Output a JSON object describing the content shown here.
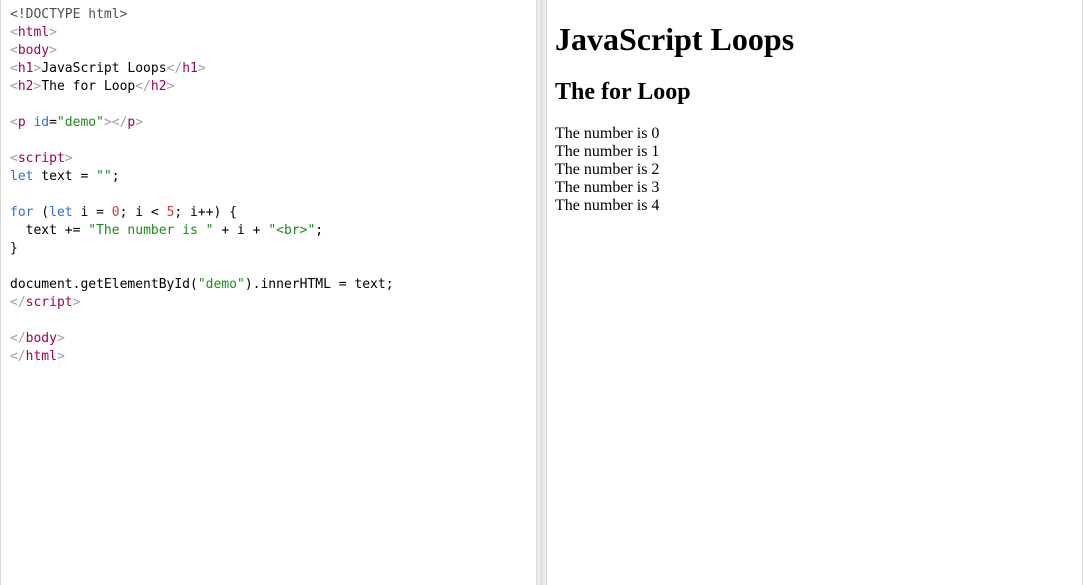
{
  "editor": {
    "lines": [
      [
        {
          "t": "doctype",
          "v": "<!DOCTYPE html>"
        }
      ],
      [
        {
          "t": "bracket",
          "v": "<"
        },
        {
          "t": "tag",
          "v": "html"
        },
        {
          "t": "bracket",
          "v": ">"
        }
      ],
      [
        {
          "t": "bracket",
          "v": "<"
        },
        {
          "t": "tag",
          "v": "body"
        },
        {
          "t": "bracket",
          "v": ">"
        }
      ],
      [
        {
          "t": "bracket",
          "v": "<"
        },
        {
          "t": "tag",
          "v": "h1"
        },
        {
          "t": "bracket",
          "v": ">"
        },
        {
          "t": "text",
          "v": "JavaScript Loops"
        },
        {
          "t": "bracket",
          "v": "</"
        },
        {
          "t": "tag",
          "v": "h1"
        },
        {
          "t": "bracket",
          "v": ">"
        }
      ],
      [
        {
          "t": "bracket",
          "v": "<"
        },
        {
          "t": "tag",
          "v": "h2"
        },
        {
          "t": "bracket",
          "v": ">"
        },
        {
          "t": "text",
          "v": "The for Loop"
        },
        {
          "t": "bracket",
          "v": "</"
        },
        {
          "t": "tag",
          "v": "h2"
        },
        {
          "t": "bracket",
          "v": ">"
        }
      ],
      [],
      [
        {
          "t": "bracket",
          "v": "<"
        },
        {
          "t": "tag",
          "v": "p"
        },
        {
          "t": "text",
          "v": " "
        },
        {
          "t": "attr",
          "v": "id"
        },
        {
          "t": "text",
          "v": "="
        },
        {
          "t": "str",
          "v": "\"demo\""
        },
        {
          "t": "bracket",
          "v": "></"
        },
        {
          "t": "tag",
          "v": "p"
        },
        {
          "t": "bracket",
          "v": ">"
        }
      ],
      [],
      [
        {
          "t": "bracket",
          "v": "<"
        },
        {
          "t": "tag",
          "v": "script"
        },
        {
          "t": "bracket",
          "v": ">"
        }
      ],
      [
        {
          "t": "kw",
          "v": "let"
        },
        {
          "t": "text",
          "v": " text = "
        },
        {
          "t": "str",
          "v": "\"\""
        },
        {
          "t": "text",
          "v": ";"
        }
      ],
      [],
      [
        {
          "t": "kw",
          "v": "for"
        },
        {
          "t": "text",
          "v": " ("
        },
        {
          "t": "kw",
          "v": "let"
        },
        {
          "t": "text",
          "v": " i = "
        },
        {
          "t": "num",
          "v": "0"
        },
        {
          "t": "text",
          "v": "; i < "
        },
        {
          "t": "num",
          "v": "5"
        },
        {
          "t": "text",
          "v": "; i++) {"
        }
      ],
      [
        {
          "t": "text",
          "v": "  text += "
        },
        {
          "t": "str",
          "v": "\"The number is \""
        },
        {
          "t": "text",
          "v": " + i + "
        },
        {
          "t": "str",
          "v": "\"<br>\""
        },
        {
          "t": "text",
          "v": ";"
        }
      ],
      [
        {
          "t": "text",
          "v": "}"
        }
      ],
      [],
      [
        {
          "t": "text",
          "v": "document.getElementById("
        },
        {
          "t": "str",
          "v": "\"demo\""
        },
        {
          "t": "text",
          "v": ").innerHTML = text;"
        }
      ],
      [
        {
          "t": "bracket",
          "v": "</"
        },
        {
          "t": "tag",
          "v": "script"
        },
        {
          "t": "bracket",
          "v": ">"
        }
      ],
      [],
      [
        {
          "t": "bracket",
          "v": "</"
        },
        {
          "t": "tag",
          "v": "body"
        },
        {
          "t": "bracket",
          "v": ">"
        }
      ],
      [
        {
          "t": "bracket",
          "v": "</"
        },
        {
          "t": "tag",
          "v": "html"
        },
        {
          "t": "bracket",
          "v": ">"
        }
      ]
    ]
  },
  "preview": {
    "h1": "JavaScript Loops",
    "h2": "The for Loop",
    "demo_lines": [
      "The number is 0",
      "The number is 1",
      "The number is 2",
      "The number is 3",
      "The number is 4"
    ]
  }
}
